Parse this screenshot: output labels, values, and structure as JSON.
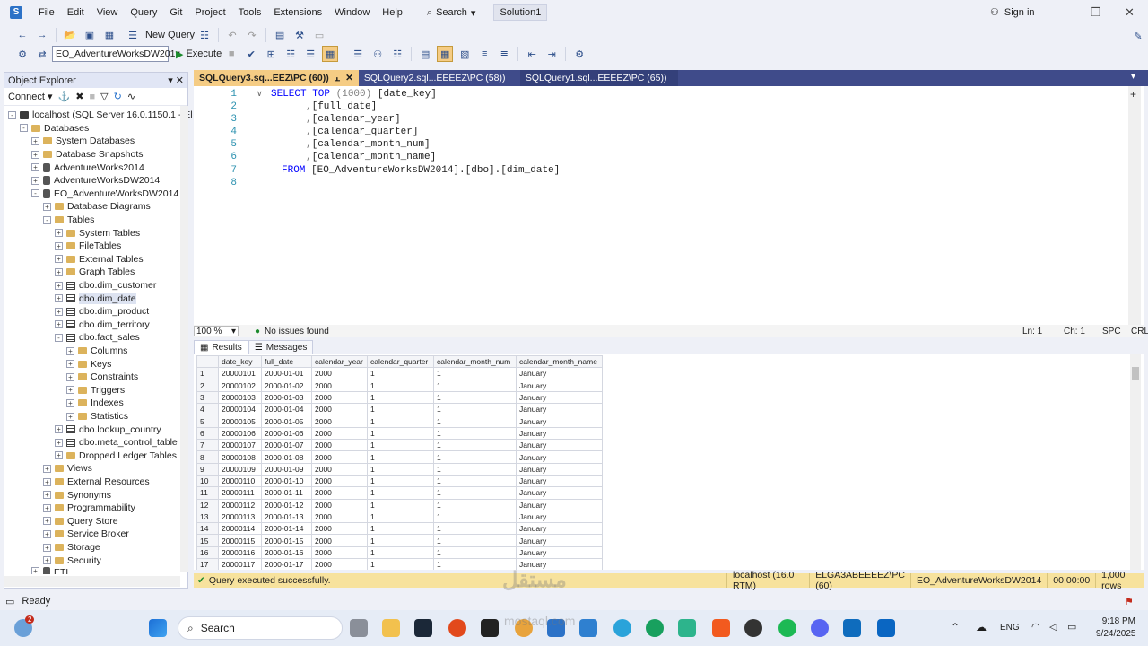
{
  "menu": [
    "File",
    "Edit",
    "View",
    "Query",
    "Git",
    "Project",
    "Tools",
    "Extensions",
    "Window",
    "Help"
  ],
  "search_label": "Search",
  "solution_name": "Solution1",
  "signin_label": "Sign in",
  "toolbar": {
    "new_query": "New Query",
    "database": "EO_AdventureWorksDW201",
    "execute": "Execute"
  },
  "object_explorer": {
    "title": "Object Explorer",
    "connect": "Connect",
    "server": "localhost (SQL Server 16.0.1150.1 - El",
    "databases": "Databases",
    "system_databases": "System Databases",
    "database_snapshots": "Database Snapshots",
    "db1": "AdventureWorks2014",
    "db2": "AdventureWorksDW2014",
    "db3": "EO_AdventureWorksDW2014",
    "diagrams": "Database Diagrams",
    "tables": "Tables",
    "system_tables": "System Tables",
    "file_tables": "FileTables",
    "external_tables": "External Tables",
    "graph_tables": "Graph Tables",
    "t_customer": "dbo.dim_customer",
    "t_date": "dbo.dim_date",
    "t_product": "dbo.dim_product",
    "t_territory": "dbo.dim_territory",
    "t_fact": "dbo.fact_sales",
    "columns": "Columns",
    "keys": "Keys",
    "constraints": "Constraints",
    "triggers": "Triggers",
    "indexes": "Indexes",
    "statistics": "Statistics",
    "t_lookup": "dbo.lookup_country",
    "t_meta": "dbo.meta_control_table",
    "dropped": "Dropped Ledger Tables",
    "views": "Views",
    "external_resources": "External Resources",
    "synonyms": "Synonyms",
    "programmability": "Programmability",
    "query_store": "Query Store",
    "service_broker": "Service Broker",
    "storage": "Storage",
    "security": "Security",
    "etl": "ETL"
  },
  "tabs": [
    "SQLQuery3.sq...EEZ\\PC (60))",
    "SQLQuery2.sql...EEEEZ\\PC (58))",
    "SQLQuery1.sql...EEEEZ\\PC (65))"
  ],
  "editor": {
    "line_numbers": [
      "1",
      "2",
      "3",
      "4",
      "5",
      "6",
      "7",
      "8"
    ],
    "lines": [
      {
        "kw": "SELECT TOP ",
        "gr": "(1000) ",
        "rest": "[date_key]"
      },
      {
        "kw": "",
        "gr": ",",
        "rest": "[full_date]"
      },
      {
        "kw": "",
        "gr": ",",
        "rest": "[calendar_year]"
      },
      {
        "kw": "",
        "gr": ",",
        "rest": "[calendar_quarter]"
      },
      {
        "kw": "",
        "gr": ",",
        "rest": "[calendar_month_num]"
      },
      {
        "kw": "",
        "gr": ",",
        "rest": "[calendar_month_name]"
      },
      {
        "kw": "FROM ",
        "gr": "",
        "rest": "[EO_AdventureWorksDW2014].[dbo].[dim_date]"
      },
      {
        "kw": "",
        "gr": "",
        "rest": ""
      }
    ]
  },
  "editor_status": {
    "zoom": "100 %",
    "issues": "No issues found",
    "ln": "Ln: 1",
    "ch": "Ch: 1",
    "spc": "SPC",
    "crlf": "CRLF"
  },
  "results_tabs": [
    "Results",
    "Messages"
  ],
  "grid": {
    "columns": [
      "date_key",
      "full_date",
      "calendar_year",
      "calendar_quarter",
      "calendar_month_num",
      "calendar_month_name"
    ],
    "rows": [
      [
        "1",
        "20000101",
        "2000-01-01",
        "2000",
        "1",
        "1",
        "January"
      ],
      [
        "2",
        "20000102",
        "2000-01-02",
        "2000",
        "1",
        "1",
        "January"
      ],
      [
        "3",
        "20000103",
        "2000-01-03",
        "2000",
        "1",
        "1",
        "January"
      ],
      [
        "4",
        "20000104",
        "2000-01-04",
        "2000",
        "1",
        "1",
        "January"
      ],
      [
        "5",
        "20000105",
        "2000-01-05",
        "2000",
        "1",
        "1",
        "January"
      ],
      [
        "6",
        "20000106",
        "2000-01-06",
        "2000",
        "1",
        "1",
        "January"
      ],
      [
        "7",
        "20000107",
        "2000-01-07",
        "2000",
        "1",
        "1",
        "January"
      ],
      [
        "8",
        "20000108",
        "2000-01-08",
        "2000",
        "1",
        "1",
        "January"
      ],
      [
        "9",
        "20000109",
        "2000-01-09",
        "2000",
        "1",
        "1",
        "January"
      ],
      [
        "10",
        "20000110",
        "2000-01-10",
        "2000",
        "1",
        "1",
        "January"
      ],
      [
        "11",
        "20000111",
        "2000-01-11",
        "2000",
        "1",
        "1",
        "January"
      ],
      [
        "12",
        "20000112",
        "2000-01-12",
        "2000",
        "1",
        "1",
        "January"
      ],
      [
        "13",
        "20000113",
        "2000-01-13",
        "2000",
        "1",
        "1",
        "January"
      ],
      [
        "14",
        "20000114",
        "2000-01-14",
        "2000",
        "1",
        "1",
        "January"
      ],
      [
        "15",
        "20000115",
        "2000-01-15",
        "2000",
        "1",
        "1",
        "January"
      ],
      [
        "16",
        "20000116",
        "2000-01-16",
        "2000",
        "1",
        "1",
        "January"
      ],
      [
        "17",
        "20000117",
        "2000-01-17",
        "2000",
        "1",
        "1",
        "January"
      ]
    ]
  },
  "query_status": {
    "message": "Query executed successfully.",
    "server": "localhost (16.0 RTM)",
    "user": "ELGA3ABEEEEZ\\PC (60)",
    "database": "EO_AdventureWorksDW2014",
    "time": "00:00:00",
    "rows": "1,000 rows"
  },
  "app_status": "Ready",
  "taskbar": {
    "search": "Search",
    "lang": "ENG",
    "time": "9:18 PM",
    "date": "9/24/2025",
    "notif_count": "2"
  },
  "watermark": {
    "arabic": "مستقل",
    "latin": "mostaql.com"
  },
  "colors": {
    "accent": "#3f4b8a",
    "active_tab": "#f5cc84",
    "status_bar": "#f7e29d"
  }
}
